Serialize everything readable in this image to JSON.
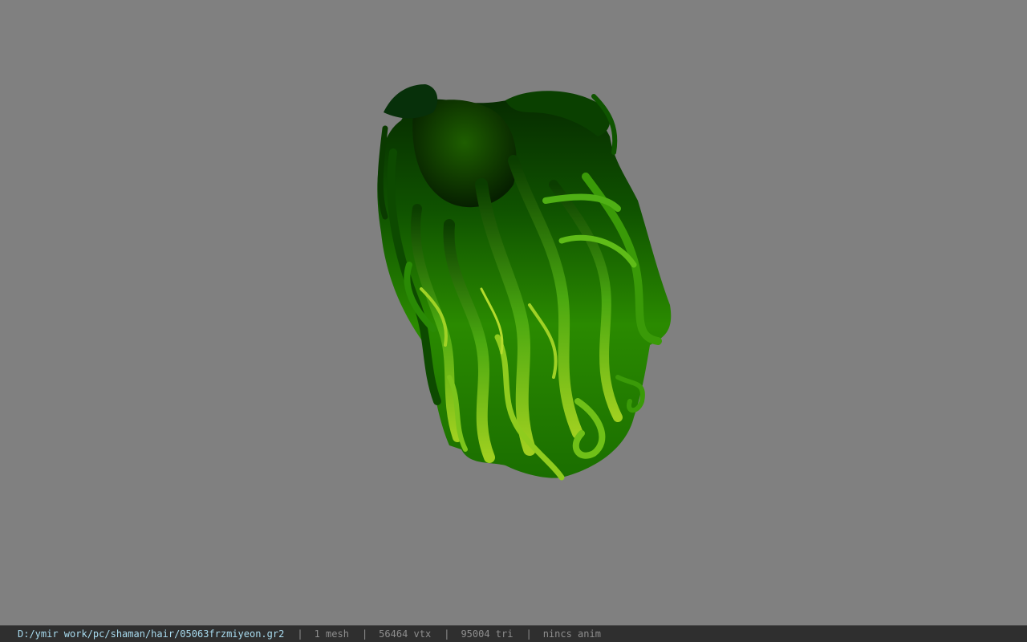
{
  "viewport": {
    "background_color": "#808080",
    "model": {
      "description_icon": "hair-mesh-preview",
      "primary_color": "#1f8a00",
      "dark_color": "#0a3300",
      "highlight_color": "#9fd020"
    }
  },
  "status_bar": {
    "file_path": "D:/ymir work/pc/shaman/hair/05063frzmiyeon.gr2",
    "separator": "|",
    "mesh_count": "1 mesh",
    "vertex_count": "56464 vtx",
    "triangle_count": "95004 tri",
    "anim_status": "nincs anim",
    "file_color": "#a9dcf0",
    "text_color": "#8e8e8e",
    "background_color": "#2f2f2f"
  }
}
